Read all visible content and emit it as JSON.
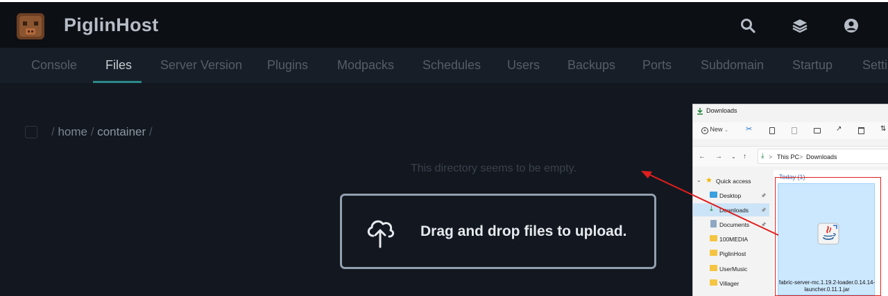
{
  "app": {
    "title": "PiglinHost"
  },
  "header_icons": [
    "search-icon",
    "layers-icon",
    "account-icon"
  ],
  "tabs": [
    {
      "label": "Console"
    },
    {
      "label": "Files"
    },
    {
      "label": "Server Version"
    },
    {
      "label": "Plugins"
    },
    {
      "label": "Modpacks"
    },
    {
      "label": "Schedules"
    },
    {
      "label": "Users"
    },
    {
      "label": "Backups"
    },
    {
      "label": "Ports"
    },
    {
      "label": "Subdomain"
    },
    {
      "label": "Startup"
    },
    {
      "label": "Setti"
    }
  ],
  "active_tab": "Files",
  "breadcrumb": {
    "sep": "/",
    "home": "home",
    "container": "container"
  },
  "empty_message": "This directory seems to be empty.",
  "drop_zone": {
    "text": "Drag and drop files to upload."
  },
  "explorer": {
    "title": "Downloads",
    "toolbar": {
      "new_label": "New"
    },
    "address": {
      "this_pc": "This PC",
      "sep": ">",
      "downloads": "Downloads"
    },
    "nav": [
      {
        "label": "Quick access",
        "icon": "star-icon",
        "pinned": false
      },
      {
        "label": "Desktop",
        "icon": "desktop-folder-icon",
        "pinned": true
      },
      {
        "label": "Downloads",
        "icon": "download-icon",
        "pinned": true,
        "selected": true
      },
      {
        "label": "Documents",
        "icon": "documents-icon",
        "pinned": true
      },
      {
        "label": "100MEDIA",
        "icon": "folder-icon",
        "pinned": false
      },
      {
        "label": "PiglinHost",
        "icon": "folder-icon",
        "pinned": false
      },
      {
        "label": "UserMusic",
        "icon": "folder-icon",
        "pinned": false
      },
      {
        "label": "Villager",
        "icon": "folder-icon",
        "pinned": false
      }
    ],
    "group_header": "Today (1)",
    "file": {
      "name": "fabric-server-mc.1.19.2-loader.0.14.14-launcher.0.11.1.jar",
      "icon": "java-jar-icon"
    }
  },
  "colors": {
    "accent": "#2b8a8a",
    "annotation": "#e01e1e",
    "selection": "#cce8ff"
  }
}
